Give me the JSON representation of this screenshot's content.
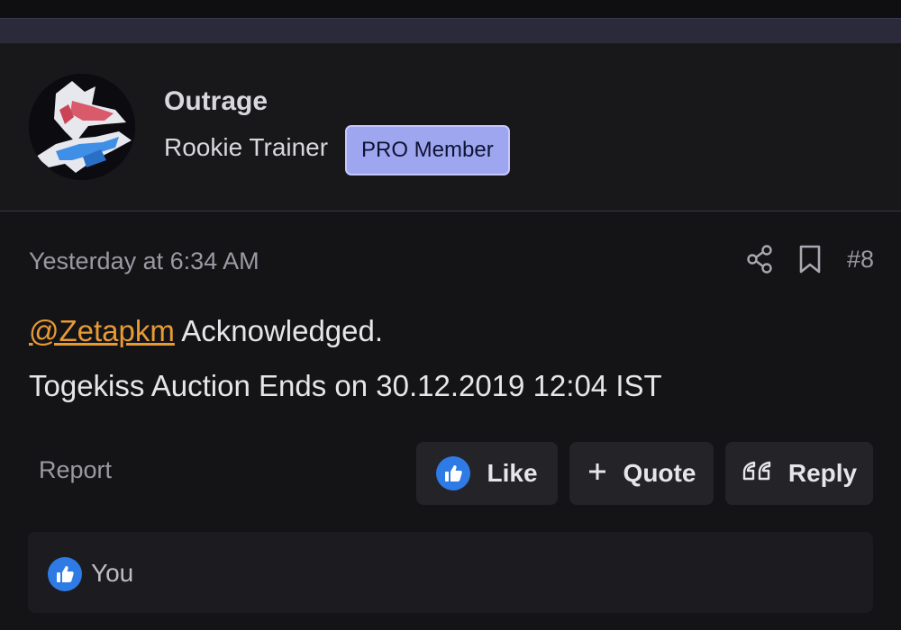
{
  "author": {
    "username": "Outrage",
    "user_title": "Rookie Trainer",
    "badge": "PRO Member",
    "avatar": "latias-latios-avatar"
  },
  "post": {
    "timestamp": "Yesterday at 6:34 AM",
    "post_number": "#8",
    "mention": "@Zetapkm",
    "line1_text": " Acknowledged.",
    "line2": "Togekiss Auction Ends on 30.12.2019 12:04 IST",
    "icons": [
      "share-icon",
      "bookmark-icon"
    ]
  },
  "actions": {
    "report": "Report",
    "like": "Like",
    "quote": "Quote",
    "reply": "Reply"
  },
  "reactions": {
    "user": "You",
    "icon": "thumbs-up-icon"
  },
  "colors": {
    "accent_mention": "#e89a35",
    "like_blue": "#2f7be6",
    "badge_bg": "#9fa6f0"
  }
}
